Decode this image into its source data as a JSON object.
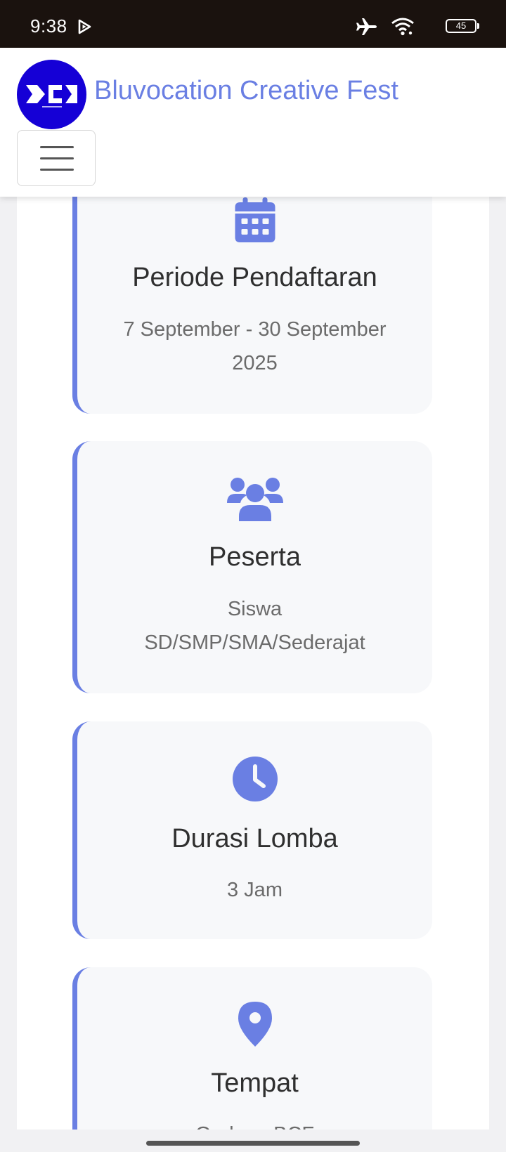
{
  "status_bar": {
    "time": "9:38",
    "battery_level": "45",
    "icons": [
      "play-icon",
      "airplane-icon",
      "wifi-icon",
      "battery-icon"
    ]
  },
  "navbar": {
    "brand_title": "Bluvocation Creative Fest",
    "logo_icon": "logo-icon",
    "menu_icon": "hamburger-icon"
  },
  "cards": [
    {
      "icon": "calendar-icon",
      "title": "Periode Pendaftaran",
      "line1": "7 September - 30 September",
      "line2": "2025"
    },
    {
      "icon": "users-icon",
      "title": "Peserta",
      "line1": "Siswa",
      "line2": "SD/SMP/SMA/Sederajat"
    },
    {
      "icon": "clock-icon",
      "title": "Durasi Lomba",
      "line1": "3 Jam"
    },
    {
      "icon": "location-pin-icon",
      "title": "Tempat",
      "line1": "Gedung BCF"
    }
  ],
  "colors": {
    "accent": "#6a7fe3",
    "logo_bg": "#1500d6",
    "status_bar": "#1a120e",
    "card_bg": "#f7f8fa"
  }
}
